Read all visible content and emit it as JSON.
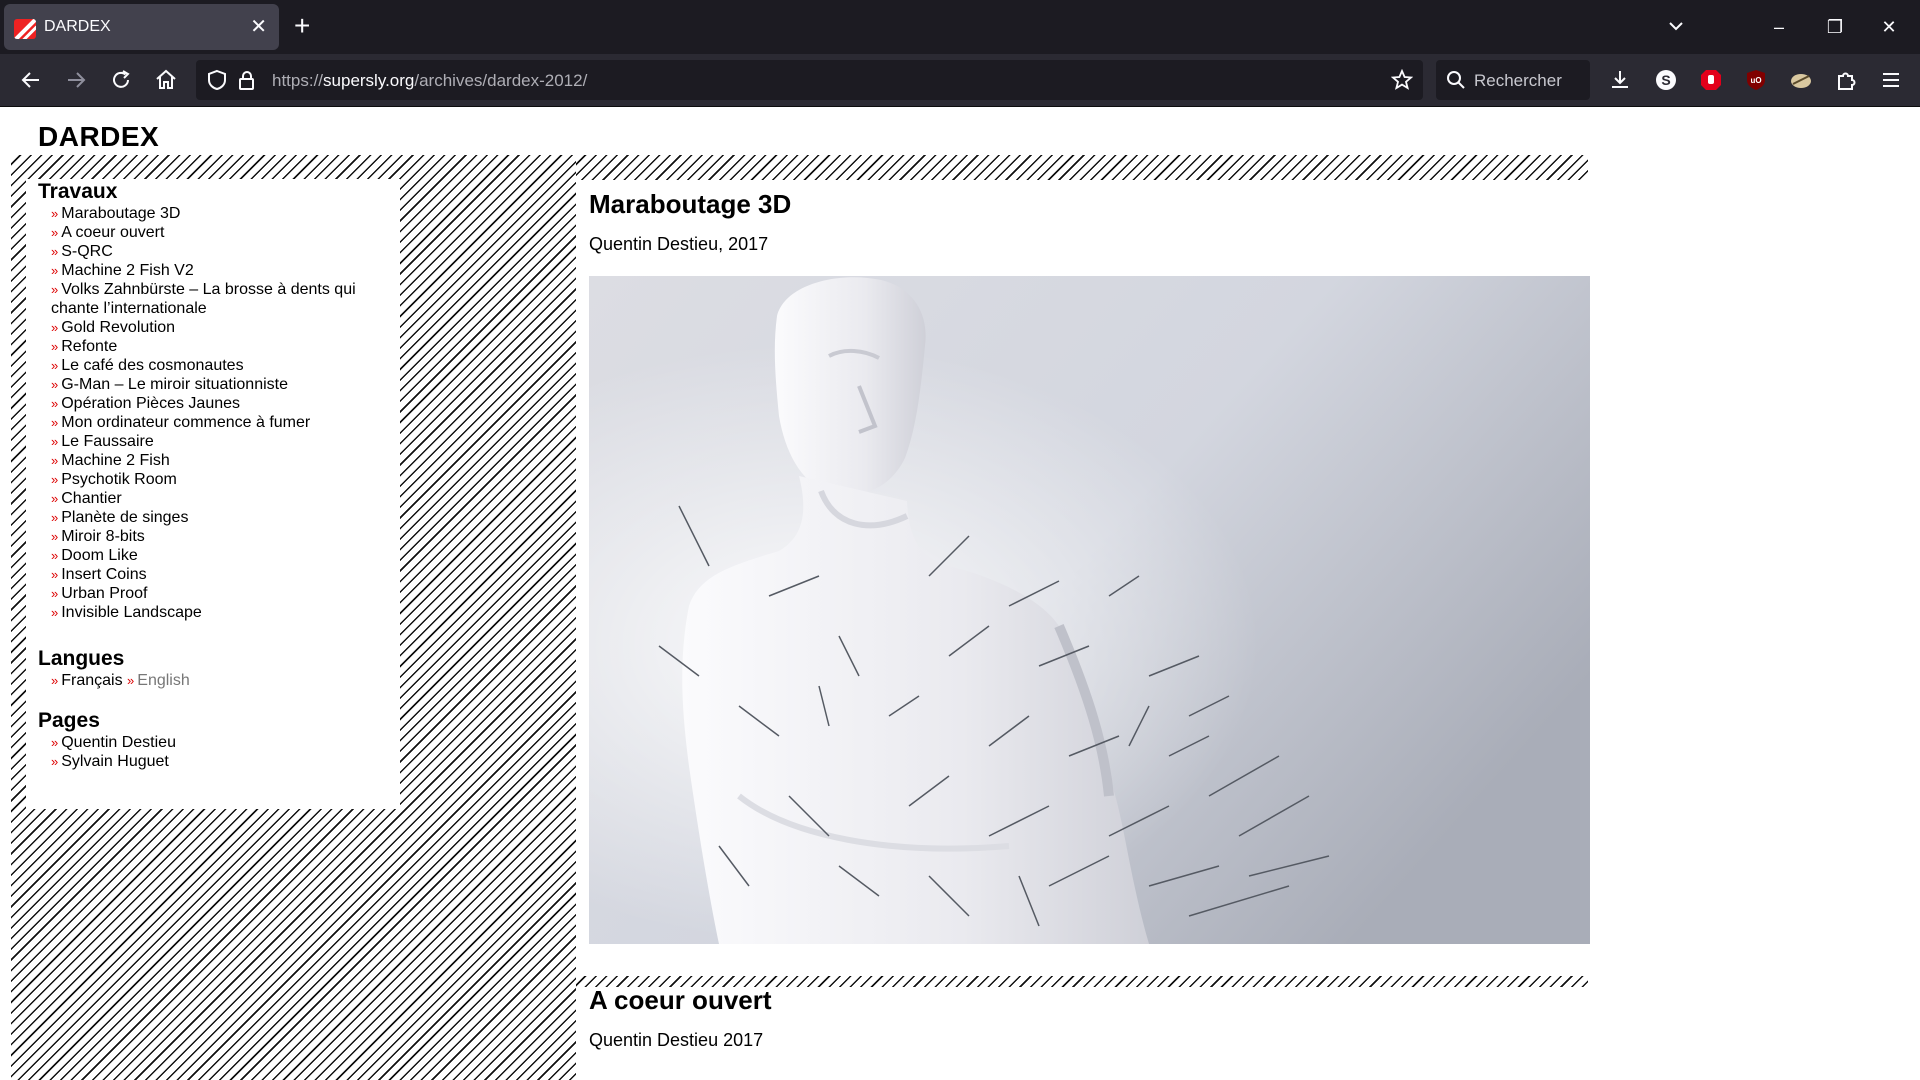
{
  "browser": {
    "tab_title": "DARDEX",
    "url_prefix": "https://",
    "url_domain": "supersly.org",
    "url_path": "/archives/dardex-2012/",
    "search_placeholder": "Rechercher"
  },
  "site": {
    "title": "DARDEX"
  },
  "sidebar": {
    "works_heading": "Travaux",
    "works": [
      "Maraboutage 3D",
      "A coeur ouvert",
      "S-QRC",
      "Machine 2 Fish V2",
      "Volks Zahnbürste – La brosse à dents qui chante l’internationale",
      "Gold Revolution",
      "Refonte",
      "Le café des cosmonautes",
      "G-Man – Le miroir situationniste",
      "Opération Pièces Jaunes",
      "Mon ordinateur commence à fumer",
      "Le Faussaire",
      "Machine 2 Fish",
      "Psychotik Room",
      "Chantier",
      "Planète de singes",
      "Miroir 8-bits",
      "Doom Like",
      "Insert Coins",
      "Urban Proof",
      "Invisible Landscape"
    ],
    "languages_heading": "Langues",
    "language_fr": "Français",
    "language_en": "English",
    "pages_heading": "Pages",
    "pages": [
      "Quentin Destieu",
      "Sylvain Huguet"
    ],
    "bullet": "»"
  },
  "posts": [
    {
      "title": "Maraboutage 3D",
      "meta": "Quentin Destieu, 2017"
    },
    {
      "title": "A coeur ouvert",
      "meta": "Quentin Destieu 2017"
    }
  ],
  "colors": {
    "bullet": "#dd0000",
    "chrome_dark": "#1c1b22",
    "toolbar": "#2b2a33"
  }
}
